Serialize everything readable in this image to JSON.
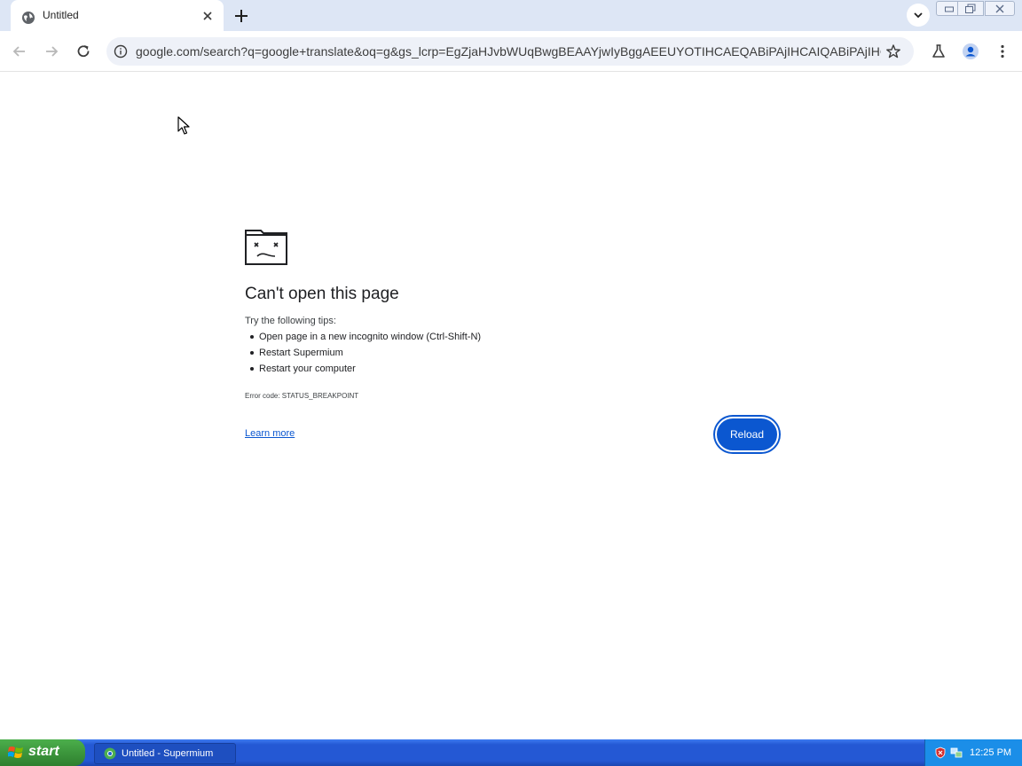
{
  "browser": {
    "tab": {
      "title": "Untitled",
      "favicon": "globe-icon"
    },
    "address_bar": {
      "url": "google.com/search?q=google+translate&oq=g&gs_lcrp=EgZjaHJvbWUqBwgBEAAYjwIyBggAEEUYOTIHCAEQABiPAjIHCAIQABiPAjIHC..."
    }
  },
  "error_page": {
    "title": "Can't open this page",
    "tips_heading": "Try the following tips:",
    "tips": [
      "Open page in a new incognito window (Ctrl-Shift-N)",
      "Restart Supermium",
      "Restart your computer"
    ],
    "error_code": "Error code: STATUS_BREAKPOINT",
    "learn_more": "Learn more",
    "reload": "Reload"
  },
  "taskbar": {
    "start": "start",
    "task_item": "Untitled - Supermium",
    "clock": "12:25 PM"
  },
  "colors": {
    "accent": "#0b57d0",
    "tabstrip": "#dde6f5",
    "taskbar": "#2458d4",
    "start_button": "#3c963c"
  }
}
